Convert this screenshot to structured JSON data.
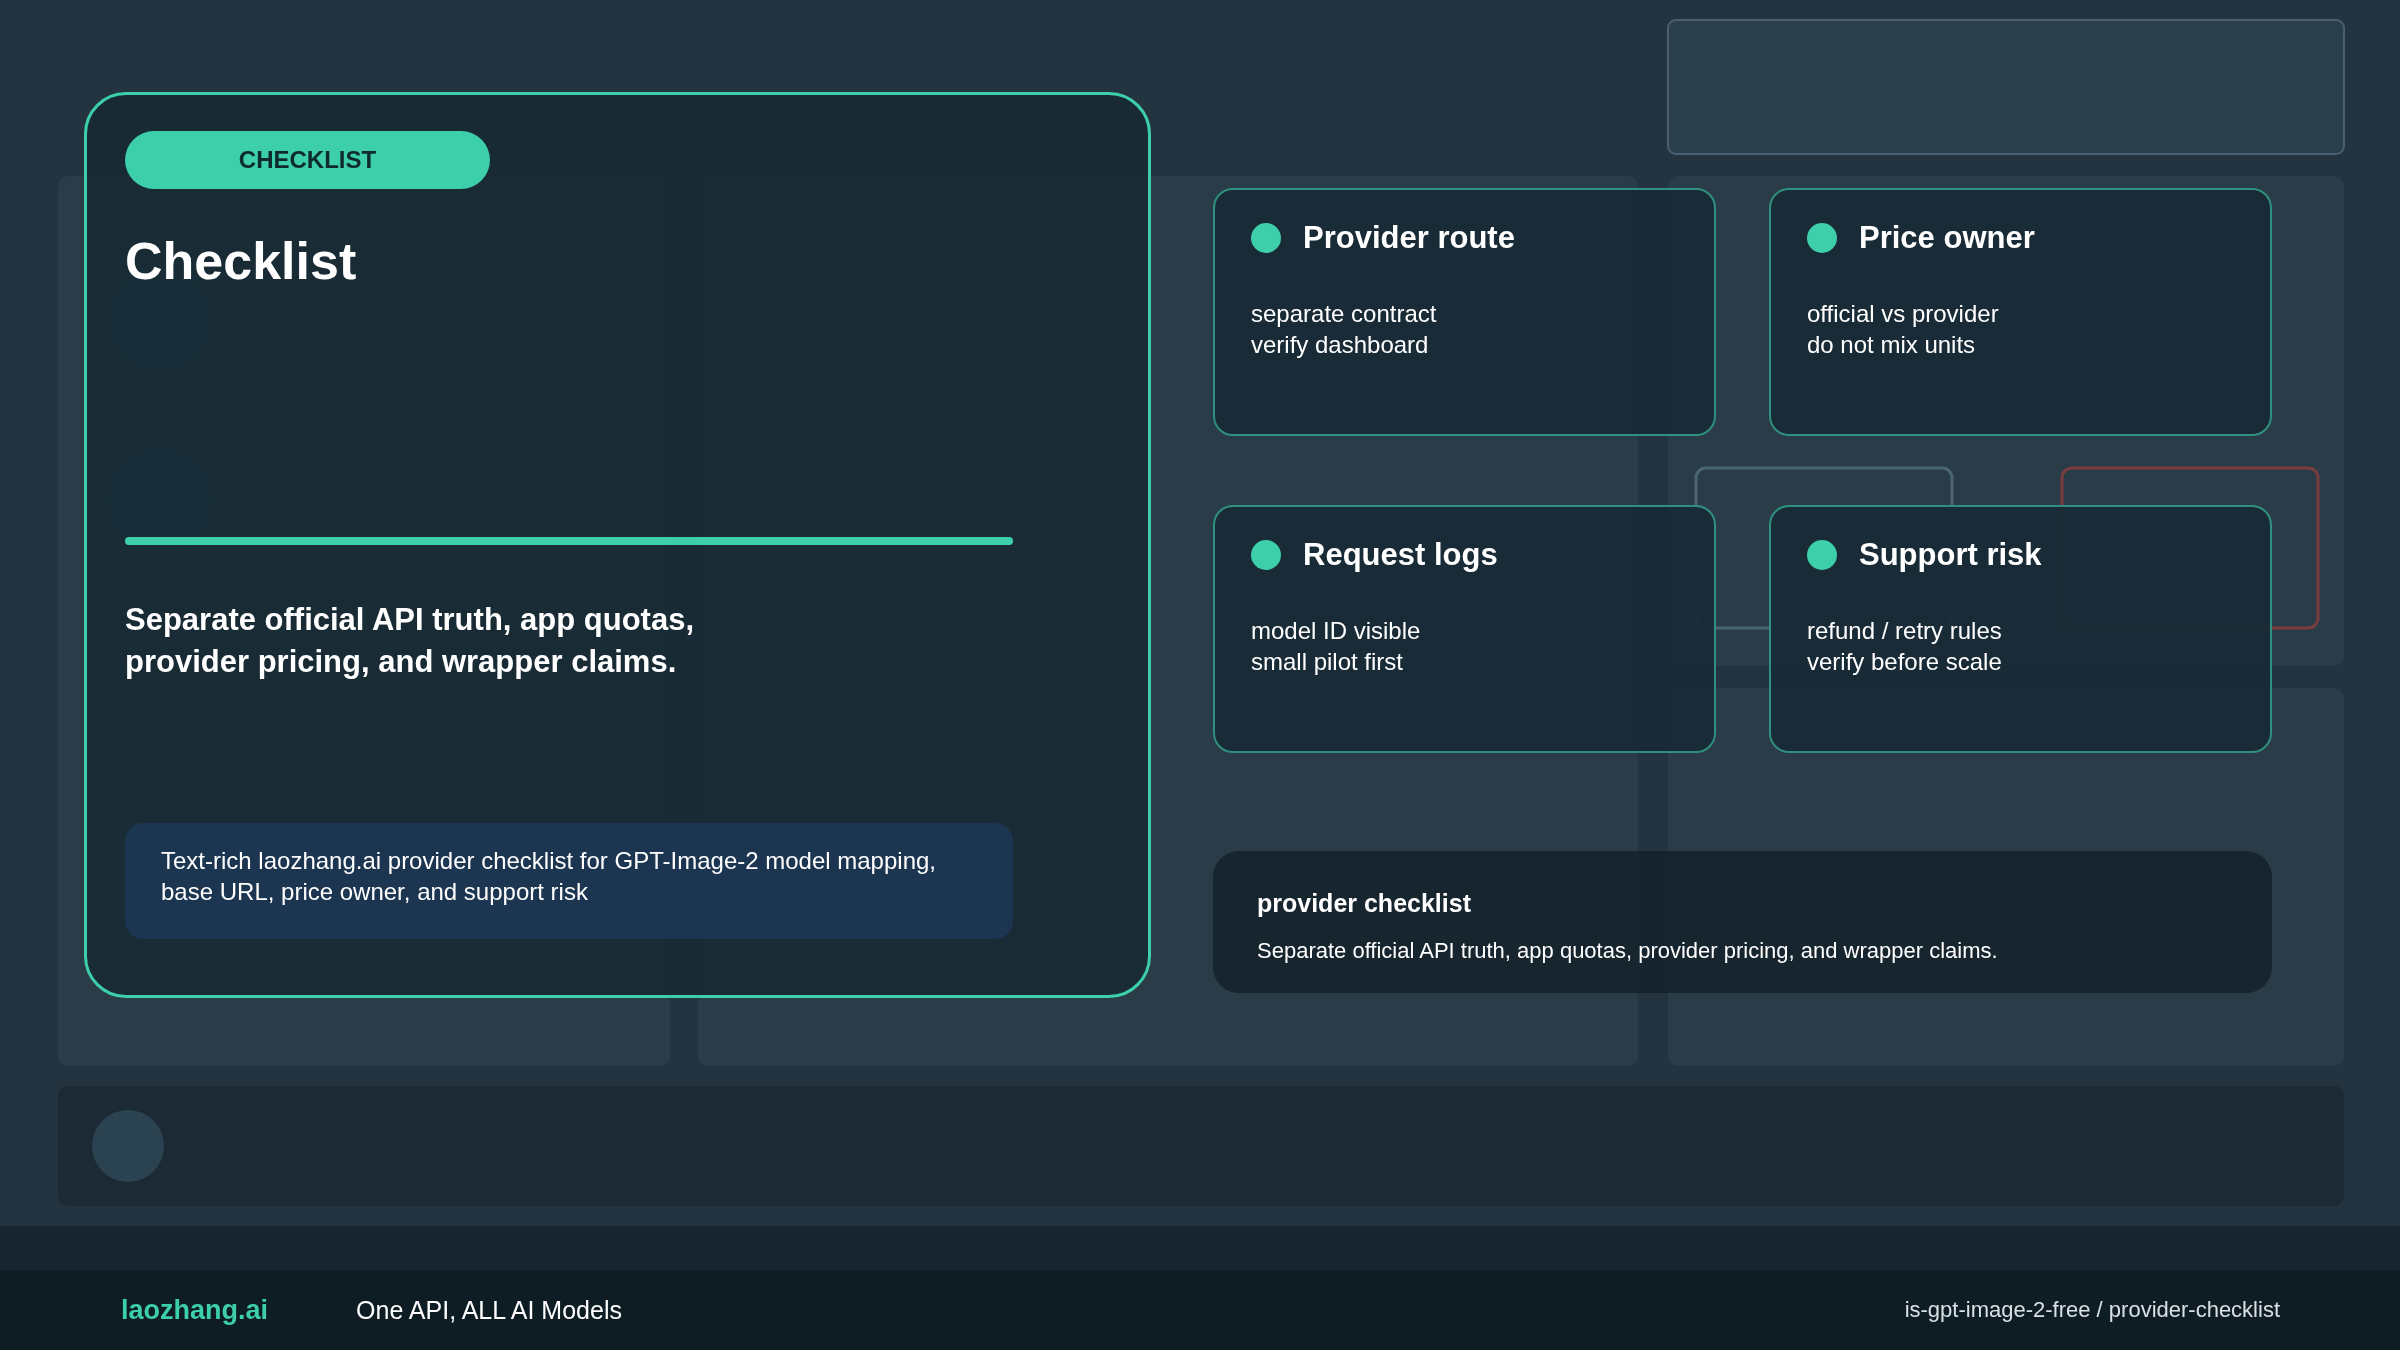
{
  "panel": {
    "badge": "CHECKLIST",
    "title": "Checklist",
    "progress": {
      "level": 1
    },
    "summary": "Separate official API truth, app quotas, provider pricing, and wrapper claims.",
    "description": "Text-rich laozhang.ai provider checklist for GPT-Image-2 model mapping, base URL, price owner, and support risk"
  },
  "cards": [
    {
      "title": "Provider route",
      "lines": [
        "separate contract",
        "verify dashboard"
      ]
    },
    {
      "title": "Price owner",
      "lines": [
        "official vs provider",
        "do not mix units"
      ]
    },
    {
      "title": "Request logs",
      "lines": [
        "model ID visible",
        "small pilot first"
      ]
    },
    {
      "title": "Support risk",
      "lines": [
        "refund / retry rules",
        "verify before scale"
      ]
    }
  ],
  "note": {
    "title": "provider checklist",
    "text": "Separate official API truth, app quotas, provider pricing, and wrapper claims."
  },
  "footer": {
    "brand": "laozhang.ai",
    "tagline": "One API, ALL AI Models",
    "path": "is-gpt-image-2-free / provider-checklist"
  }
}
